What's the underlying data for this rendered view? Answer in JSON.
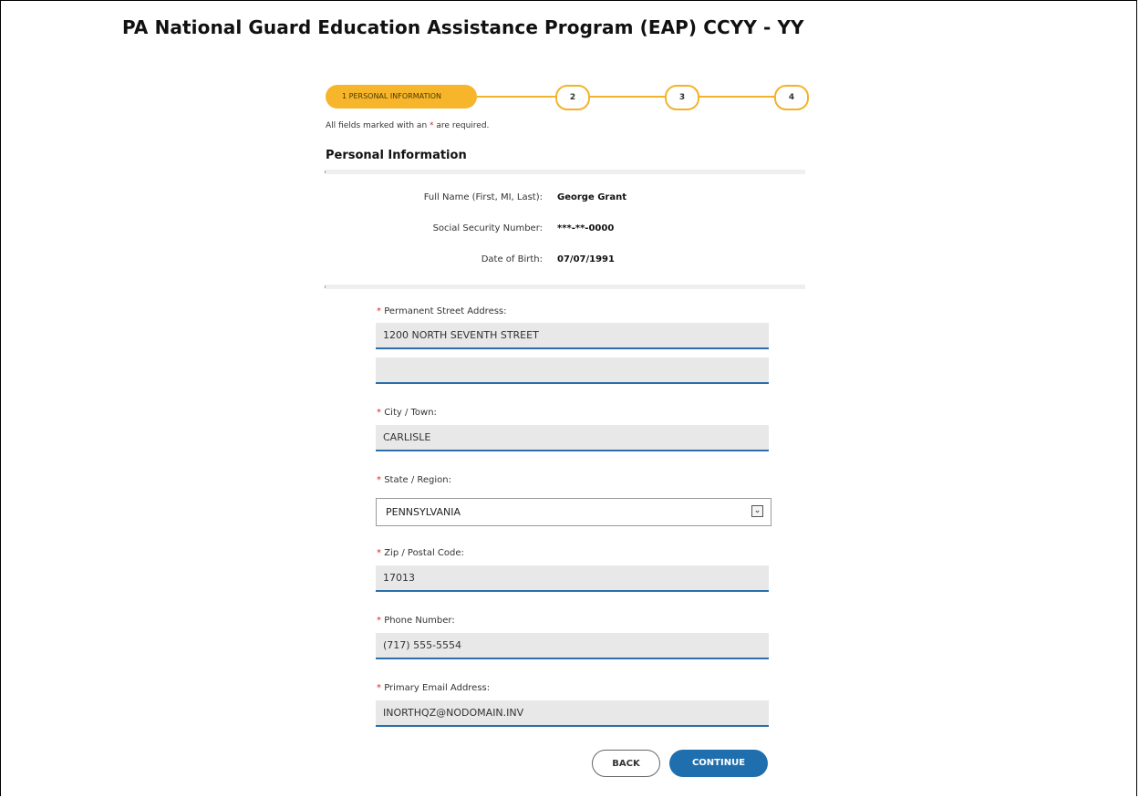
{
  "page": {
    "title": "PA National Guard Education Assistance Program (EAP) CCYY - YY"
  },
  "stepper": {
    "active_label": "1   PERSONAL INFORMATION",
    "steps": [
      "2",
      "3",
      "4"
    ]
  },
  "form": {
    "required_note_prefix": "All fields marked with an",
    "required_star": "*",
    "required_note_suffix": "are required.",
    "section_title": "Personal Information",
    "info": {
      "full_name_label": "Full Name (First, MI, Last):",
      "full_name_value": "George Grant",
      "ssn_label": "Social Security Number:",
      "ssn_value": "***-**-0000",
      "dob_label": "Date of Birth:",
      "dob_value": "07/07/1991"
    },
    "fields": {
      "street_label": "Permanent Street Address:",
      "street_line1": "1200 NORTH SEVENTH STREET",
      "street_line2": "",
      "city_label": "City / Town:",
      "city_value": "CARLISLE",
      "state_label": "State / Region:",
      "state_value": "PENNSYLVANIA",
      "zip_label": "Zip / Postal Code:",
      "zip_value": "17013",
      "phone_label": "Phone Number:",
      "phone_value": "(717) 555-5554",
      "email_label": "Primary Email Address:",
      "email_value": "INORTHQZ@NODOMAIN.INV"
    }
  },
  "buttons": {
    "back": "BACK",
    "continue": "CONTINUE"
  },
  "colors": {
    "accent_step": "#f6b52b",
    "primary_button": "#1f6fae",
    "input_underline": "#2b6ea8",
    "required_star": "#d02a2a"
  }
}
